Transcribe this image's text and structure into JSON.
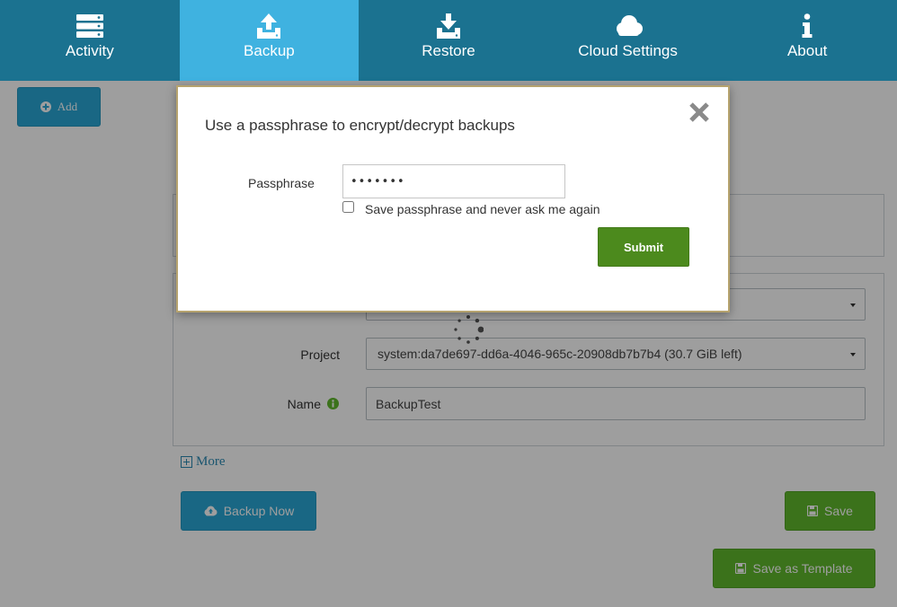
{
  "nav": {
    "items": [
      {
        "label": "Activity",
        "icon": "server-icon"
      },
      {
        "label": "Backup",
        "icon": "upload-icon"
      },
      {
        "label": "Restore",
        "icon": "download-icon"
      },
      {
        "label": "Cloud Settings",
        "icon": "cloud-icon"
      },
      {
        "label": "About",
        "icon": "info-icon"
      }
    ],
    "active": "Backup",
    "colors": {
      "bar": "#1b7290",
      "active": "#3fb2e0"
    }
  },
  "toolbar": {
    "add_label": "Add"
  },
  "form": {
    "project_label": "Project",
    "project_value": "system:da7de697-dd6a-4046-965c-20908db7b7b4 (30.7 GiB left)",
    "name_label": "Name",
    "name_value": "BackupTest",
    "more_label": "More"
  },
  "actions": {
    "backup_now": "Backup Now",
    "save": "Save",
    "save_template": "Save as Template"
  },
  "modal": {
    "title": "Use a passphrase to encrypt/decrypt backups",
    "passphrase_label": "Passphrase",
    "passphrase_value": "•••••••",
    "remember_label": "Save passphrase and never ask me again",
    "remember_checked": false,
    "submit_label": "Submit"
  }
}
